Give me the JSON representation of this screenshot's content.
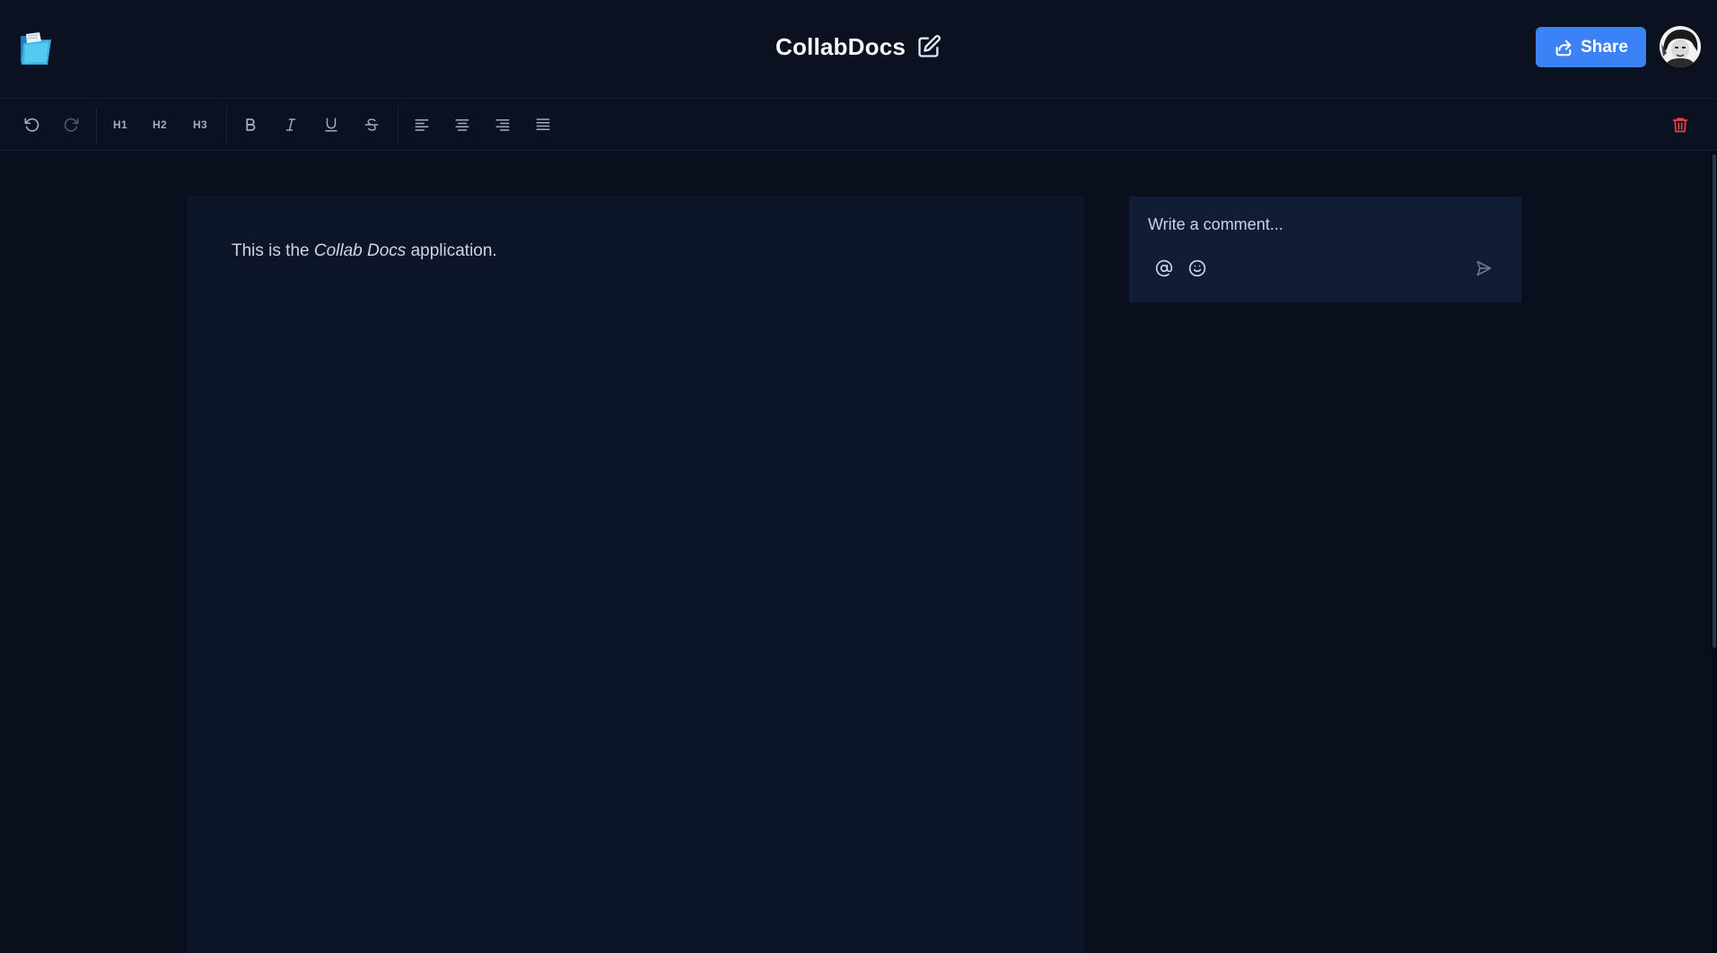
{
  "app": {
    "logo_icon": "folder-logo-icon"
  },
  "header": {
    "title": "CollabDocs",
    "edit_icon": "pencil-square-icon",
    "share_label": "Share",
    "share_icon": "share-arrow-icon",
    "avatar": "user-avatar"
  },
  "toolbar": {
    "undo_icon": "undo-icon",
    "redo_icon": "redo-icon",
    "h1_label": "H1",
    "h2_label": "H2",
    "h3_label": "H3",
    "bold_icon": "bold-icon",
    "italic_icon": "italic-icon",
    "underline_icon": "underline-icon",
    "strikethrough_icon": "strikethrough-icon",
    "align_icons": [
      "align-left-icon",
      "align-center-icon",
      "align-right-icon",
      "align-justify-icon"
    ],
    "delete_icon": "trash-icon"
  },
  "editor": {
    "text_before": "This is the ",
    "text_italic": "Collab Docs",
    "text_after": " application."
  },
  "comment": {
    "placeholder": "Write a comment...",
    "mention_icon": "at-sign-icon",
    "emoji_icon": "smiley-icon",
    "send_icon": "send-icon"
  },
  "colors": {
    "background": "#0a0f1e",
    "header_bg": "#0b1120",
    "editor_bg": "#0d1528",
    "comment_bg": "#111c36",
    "accent": "#3b82f6",
    "danger": "#ef4444"
  }
}
